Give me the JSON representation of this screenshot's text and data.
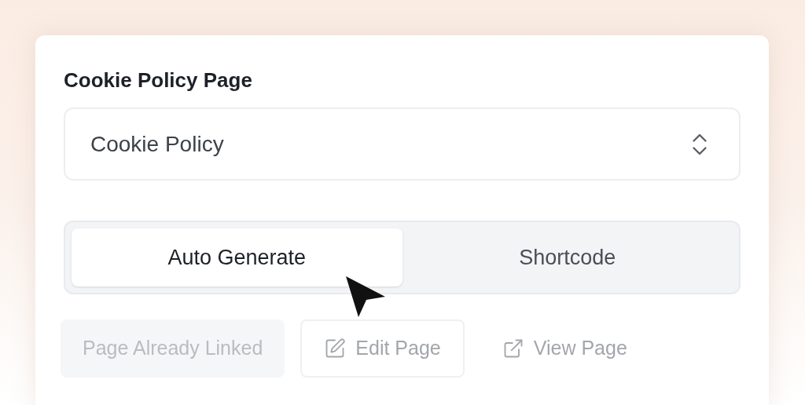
{
  "field": {
    "label": "Cookie Policy Page",
    "value": "Cookie Policy"
  },
  "tabs": [
    {
      "label": "Auto Generate",
      "selected": true
    },
    {
      "label": "Shortcode",
      "selected": false
    }
  ],
  "actions": [
    {
      "kind": "plain",
      "label": "Page Already Linked",
      "disabled": true
    },
    {
      "kind": "edit",
      "label": "Edit Page",
      "disabled": false
    },
    {
      "kind": "view",
      "label": "View Page",
      "disabled": false
    }
  ]
}
